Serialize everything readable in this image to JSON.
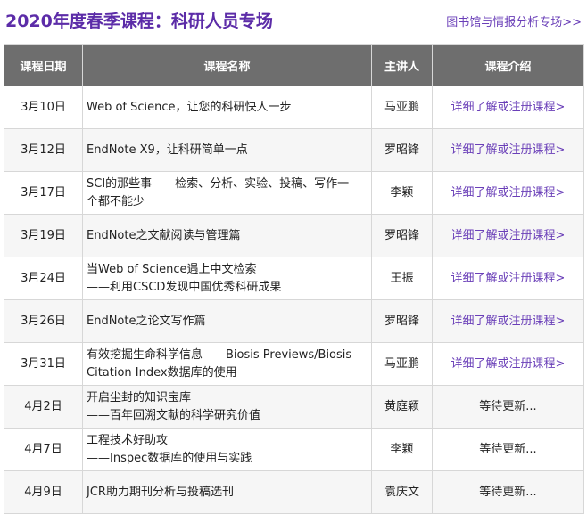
{
  "header": {
    "title": "2020年度春季课程：科研人员专场",
    "link": "图书馆与情报分析专场>>"
  },
  "table": {
    "columns": [
      "课程日期",
      "课程名称",
      "主讲人",
      "课程介绍"
    ],
    "rows": [
      {
        "date": "3月10日",
        "course": [
          "Web of Science，让您的科研快人一步"
        ],
        "speaker": "马亚鹏",
        "info": "详细了解或注册课程>",
        "link": true
      },
      {
        "date": "3月12日",
        "course": [
          "EndNote X9，让科研简单一点"
        ],
        "speaker": "罗昭锋",
        "info": "详细了解或注册课程>",
        "link": true
      },
      {
        "date": "3月17日",
        "course": [
          "SCI的那些事——检索、分析、实验、投稿、写作一",
          "个都不能少"
        ],
        "speaker": "李颖",
        "info": "详细了解或注册课程>",
        "link": true
      },
      {
        "date": "3月19日",
        "course": [
          "EndNote之文献阅读与管理篇"
        ],
        "speaker": "罗昭锋",
        "info": "详细了解或注册课程>",
        "link": true
      },
      {
        "date": "3月24日",
        "course": [
          "当Web of Science遇上中文检索",
          "——利用CSCD发现中国优秀科研成果"
        ],
        "speaker": "王振",
        "info": "详细了解或注册课程>",
        "link": true
      },
      {
        "date": "3月26日",
        "course": [
          "EndNote之论文写作篇"
        ],
        "speaker": "罗昭锋",
        "info": "详细了解或注册课程>",
        "link": true
      },
      {
        "date": "3月31日",
        "course": [
          "有效挖掘生命科学信息——Biosis Previews/Biosis",
          "Citation Index数据库的使用"
        ],
        "speaker": "马亚鹏",
        "info": "详细了解或注册课程>",
        "link": true
      },
      {
        "date": "4月2日",
        "course": [
          "开启尘封的知识宝库",
          "——百年回溯文献的科学研究价值"
        ],
        "speaker": "黄庭颖",
        "info": "等待更新...",
        "link": false
      },
      {
        "date": "4月7日",
        "course": [
          "工程技术好助攻",
          "——Inspec数据库的使用与实践"
        ],
        "speaker": "李颖",
        "info": "等待更新...",
        "link": false
      },
      {
        "date": "4月9日",
        "course": [
          "JCR助力期刊分析与投稿选刊"
        ],
        "speaker": "袁庆文",
        "info": "等待更新...",
        "link": false
      }
    ]
  }
}
